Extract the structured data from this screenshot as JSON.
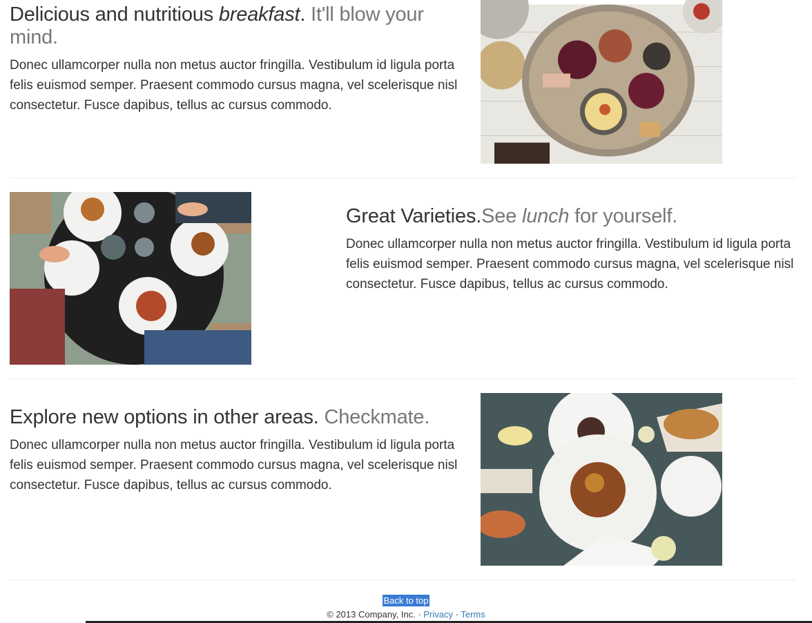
{
  "features": [
    {
      "heading_main": "Delicious and nutritious ",
      "heading_em": "breakfast",
      "heading_after": ". ",
      "heading_muted": "It'll blow your mind.",
      "body": "Donec ullamcorper nulla non metus auctor fringilla. Vestibulum id ligula porta felis euismod semper. Praesent commodo cursus magna, vel scelerisque nisl consectetur. Fusce dapibus, tellus ac cursus commodo.",
      "image_alt": "Overhead view of a breakfast board with grapes, crackers, sausages and a cheese dip"
    },
    {
      "heading_main": "Great Varieties.",
      "heading_muted_pre": "See ",
      "heading_muted_em": "lunch",
      "heading_muted_post": " for yourself.",
      "body": "Donec ullamcorper nulla non metus auctor fringilla. Vestibulum id ligula porta felis euismod semper. Praesent commodo cursus magna, vel scelerisque nisl consectetur. Fusce dapibus, tellus ac cursus commodo.",
      "image_alt": "Friends sharing burgers and fries at a round table"
    },
    {
      "heading_main": "Explore new options in other areas. ",
      "heading_muted": "Checkmate.",
      "body": "Donec ullamcorper nulla non metus auctor fringilla. Vestibulum id ligula porta felis euismod semper. Praesent commodo cursus magna, vel scelerisque nisl consectetur. Fusce dapibus, tellus ac cursus commodo.",
      "image_alt": "Restaurant table with plated dishes and a bread basket"
    }
  ],
  "footer": {
    "back_to_top": "Back to top",
    "copyright": "© 2013 Company, Inc. · ",
    "privacy": "Privacy",
    "sep": " · ",
    "terms": "Terms"
  },
  "colors": {
    "text": "#333333",
    "muted": "#777777",
    "link": "#337ab7",
    "selection": "#3a7bd5",
    "divider": "#eeeeee"
  }
}
